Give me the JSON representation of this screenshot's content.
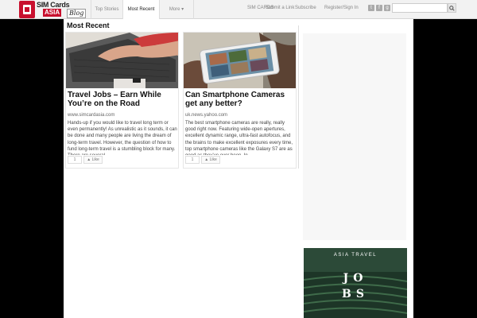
{
  "logo": {
    "line1": "SIM Cards",
    "line2": "ASIA",
    "blog": "Blog",
    "brand_color": "#c8102e"
  },
  "nav": {
    "tabs": [
      {
        "label": "Top Stories"
      },
      {
        "label": "Most Recent",
        "active": true
      },
      {
        "label": "More ▾"
      }
    ],
    "links": [
      "SIM CARDS",
      "Submit a Link",
      "Subscribe",
      "Register/Sign In"
    ],
    "social_icons": [
      "twitter-icon",
      "facebook-icon",
      "google-plus-icon"
    ],
    "search": {
      "placeholder": "",
      "button_icon": "search-icon"
    }
  },
  "main": {
    "section_title": "Most Recent",
    "cards": [
      {
        "title": "Travel Jobs – Earn While You’re on the Road",
        "source": "www.simcardasia.com",
        "body": "Hands-up if you would like to travel long term or even permanently! As unrealistic as it sounds, it can be done and many people are living the dream of long-term travel. However, the question of how to fund long-term travel is a stumbling block for many. There are several",
        "count": "1",
        "like": "Like",
        "image": "laptop-typing-photo"
      },
      {
        "title": "Can Smartphone Cameras get any better?",
        "source": "uk.news.yahoo.com",
        "body": "The best smartphone cameras are really, really good right now. Featuring wide-open apertures, excellent dynamic range, ultra-fast autofocus, and the brains to make excellent exposures every time, top smartphone cameras like the Galaxy S7 are as good as they’ve ever been. In",
        "count": "1",
        "like": "Like",
        "image": "smartphone-photo"
      }
    ]
  },
  "sidebar": {
    "ad": {
      "subtitle": "ASIA TRAVEL",
      "heading": "JOBS",
      "background": "#1d3527"
    }
  }
}
